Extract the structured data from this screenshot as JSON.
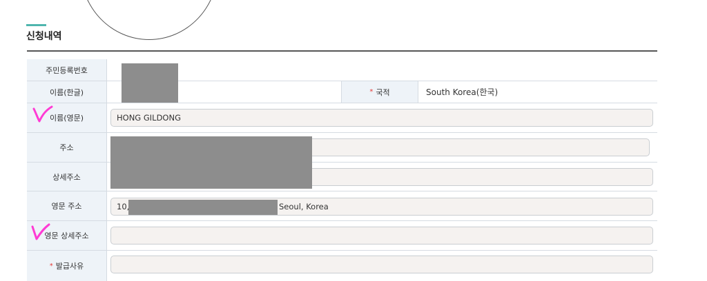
{
  "section": {
    "title": "신청내역"
  },
  "colors": {
    "accent": "#4fb5ae",
    "label_bg": "#eef3f8",
    "required": "#e53935",
    "annotation": "#ff3bd4"
  },
  "rows": {
    "resident_id": {
      "label": "주민등록번호"
    },
    "name_kr": {
      "label": "이름(한글)",
      "country_label": "국적",
      "country_value": "South Korea(한국)",
      "required_mark": "*"
    },
    "name_en": {
      "label": "이름(영문)",
      "value": "HONG GILDONG"
    },
    "address": {
      "label": "주소"
    },
    "detail_address": {
      "label": "상세주소"
    },
    "en_address": {
      "label": "영문 주소",
      "value_prefix": "10,",
      "value_suffix": "Seoul, Korea"
    },
    "en_detail_address": {
      "label": "영문 상세주소"
    },
    "issue_reason": {
      "label": "발급사유",
      "required_mark": "*"
    }
  }
}
